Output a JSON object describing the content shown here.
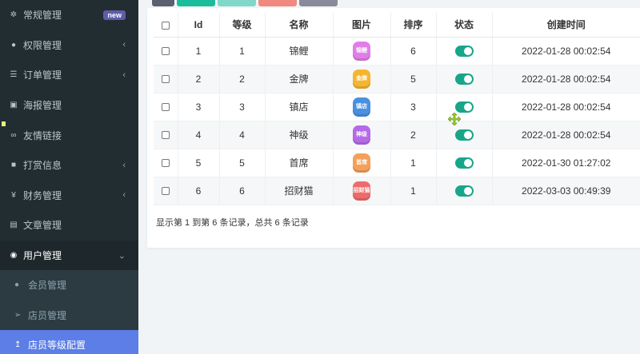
{
  "sidebar": {
    "items": [
      {
        "label": "常规管理",
        "icon": "gears-icon",
        "badge": "new"
      },
      {
        "label": "权限管理",
        "icon": "users-icon",
        "caret": "‹"
      },
      {
        "label": "订单管理",
        "icon": "list-icon",
        "caret": "‹"
      },
      {
        "label": "海报管理",
        "icon": "image-icon"
      },
      {
        "label": "友情链接",
        "icon": "link-icon"
      },
      {
        "label": "打赏信息",
        "icon": "gift-icon",
        "caret": "‹"
      },
      {
        "label": "财务管理",
        "icon": "yen-icon",
        "caret": "‹"
      },
      {
        "label": "文章管理",
        "icon": "newspaper-icon"
      },
      {
        "label": "用户管理",
        "icon": "user-circle-icon",
        "caret": "⌄"
      }
    ],
    "sub_items": [
      {
        "label": "会员管理",
        "icon": "user-icon"
      },
      {
        "label": "店员管理",
        "icon": "paper-plane-icon"
      },
      {
        "label": "店员等级配置",
        "icon": "upload-icon"
      }
    ]
  },
  "top_tab_colors": [
    "#5a6070",
    "#1abc9c",
    "#80d8c8",
    "#f08a80",
    "#8a8a9a"
  ],
  "table": {
    "headers": [
      "Id",
      "等级",
      "名称",
      "图片",
      "排序",
      "状态",
      "创建时间"
    ],
    "rows": [
      {
        "id": "1",
        "level": "1",
        "name": "锦鲤",
        "pic_text": "锦鲤",
        "pic_color": "#e07ee8",
        "sort": "6",
        "created": "2022-01-28 00:02:54"
      },
      {
        "id": "2",
        "level": "2",
        "name": "金牌",
        "pic_text": "金牌",
        "pic_color": "#f5b52e",
        "sort": "5",
        "created": "2022-01-28 00:02:54"
      },
      {
        "id": "3",
        "level": "3",
        "name": "镇店",
        "pic_text": "镇店",
        "pic_color": "#4a90e2",
        "sort": "3",
        "created": "2022-01-28 00:02:54"
      },
      {
        "id": "4",
        "level": "4",
        "name": "神级",
        "pic_text": "神级",
        "pic_color": "#b66ae8",
        "sort": "2",
        "created": "2022-01-28 00:02:54"
      },
      {
        "id": "5",
        "level": "5",
        "name": "首席",
        "pic_text": "首席",
        "pic_color": "#f5a05a",
        "sort": "1",
        "created": "2022-01-30 01:27:02"
      },
      {
        "id": "6",
        "level": "6",
        "name": "招财猫",
        "pic_text": "招财猫",
        "pic_color": "#ef6b6b",
        "sort": "1",
        "created": "2022-03-03 00:49:39"
      }
    ]
  },
  "pager_info": "显示第 1 到第 6 条记录，总共 6 条记录"
}
